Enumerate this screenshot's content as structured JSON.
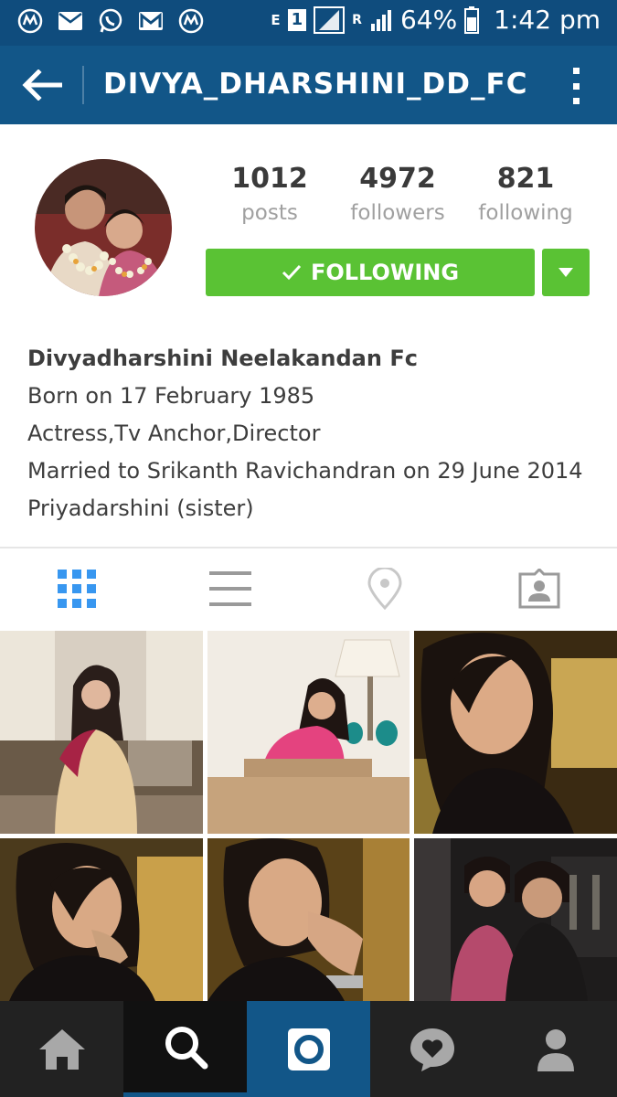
{
  "status_bar": {
    "notification_icons": [
      "myntra-icon",
      "mail-icon",
      "whatsapp-icon",
      "gmail-icon",
      "myntra-icon"
    ],
    "network_label_e": "E",
    "sim_label": "1",
    "roaming_label": "R",
    "battery_percent": "64%",
    "time": "1:42 pm"
  },
  "app_bar": {
    "title": "DIVYA_DHARSHINI_DD_FC",
    "back_icon": "back-arrow-icon",
    "menu_icon": "more-vert-icon"
  },
  "profile": {
    "stats": [
      {
        "value": "1012",
        "label": "posts"
      },
      {
        "value": "4972",
        "label": "followers"
      },
      {
        "value": "821",
        "label": "following"
      }
    ],
    "follow_button_label": "FOLLOWING",
    "bio": {
      "name": "Divyadharshini Neelakandan Fc",
      "lines": [
        "Born on 17 February 1985",
        "Actress,Tv Anchor,Director",
        "Married to Srikanth Ravichandran on 29 June 2014",
        "Priyadarshini (sister)"
      ]
    }
  },
  "tabs": [
    {
      "name": "grid-view",
      "icon": "grid-icon",
      "active": true
    },
    {
      "name": "list-view",
      "icon": "list-icon",
      "active": false
    },
    {
      "name": "location-view",
      "icon": "location-pin-icon",
      "active": false
    },
    {
      "name": "tagged-view",
      "icon": "tagged-person-icon",
      "active": false
    }
  ],
  "bottom_nav": [
    {
      "name": "home",
      "icon": "home-icon",
      "active": false
    },
    {
      "name": "search",
      "icon": "search-icon",
      "active": true
    },
    {
      "name": "camera",
      "icon": "camera-icon",
      "active": false
    },
    {
      "name": "activity",
      "icon": "heart-bubble-icon",
      "active": false
    },
    {
      "name": "profile",
      "icon": "person-icon",
      "active": false
    }
  ],
  "colors": {
    "status_bar": "#0f4c7d",
    "app_bar": "#125688",
    "follow_green": "#5ac234",
    "active_tab_blue": "#3897f0",
    "bottom_nav_bg": "#222222",
    "camera_tab_bg": "#125688"
  }
}
